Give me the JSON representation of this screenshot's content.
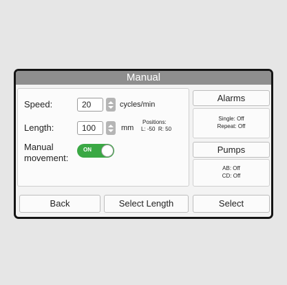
{
  "header": {
    "title": "Manual"
  },
  "settings": {
    "speed_label": "Speed:",
    "speed_value": "20",
    "speed_unit": "cycles/min",
    "length_label": "Length:",
    "length_value": "100",
    "length_unit": "mm",
    "positions_title": "Positions:",
    "positions_values": "L: -50  R: 50",
    "manual_line1": "Manual",
    "manual_line2": "movement:",
    "toggle_label": "ON"
  },
  "alarms": {
    "button_label": "Alarms",
    "single": "Single: Off",
    "repeat": "Repeat: Off"
  },
  "pumps": {
    "button_label": "Pumps",
    "ab": "AB: Off",
    "cd": "CD: Off"
  },
  "footer": {
    "back": "Back",
    "select_length": "Select Length",
    "select": "Select"
  },
  "colors": {
    "title_bar": "#8e8e8e",
    "toggle_on": "#3aa844",
    "frame": "#141414"
  }
}
